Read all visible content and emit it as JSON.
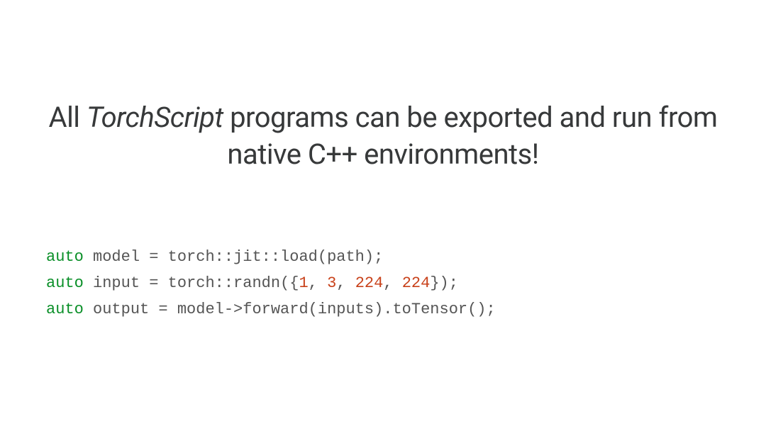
{
  "heading": {
    "prefix": "All ",
    "emphasis": "TorchScript",
    "suffix": " programs can be exported and run from native C++ environments!"
  },
  "code": {
    "lines": [
      {
        "kw": "auto",
        "rest": " model = torch::jit::load(path);"
      },
      {
        "kw": "auto",
        "rest_parts": [
          {
            "t": " input = torch::randn({"
          },
          {
            "n": "1"
          },
          {
            "t": ", "
          },
          {
            "n": "3"
          },
          {
            "t": ", "
          },
          {
            "n": "224"
          },
          {
            "t": ", "
          },
          {
            "n": "224"
          },
          {
            "t": "});"
          }
        ]
      },
      {
        "kw": "auto",
        "rest": " output = model->forward(inputs).toTensor();"
      }
    ]
  }
}
